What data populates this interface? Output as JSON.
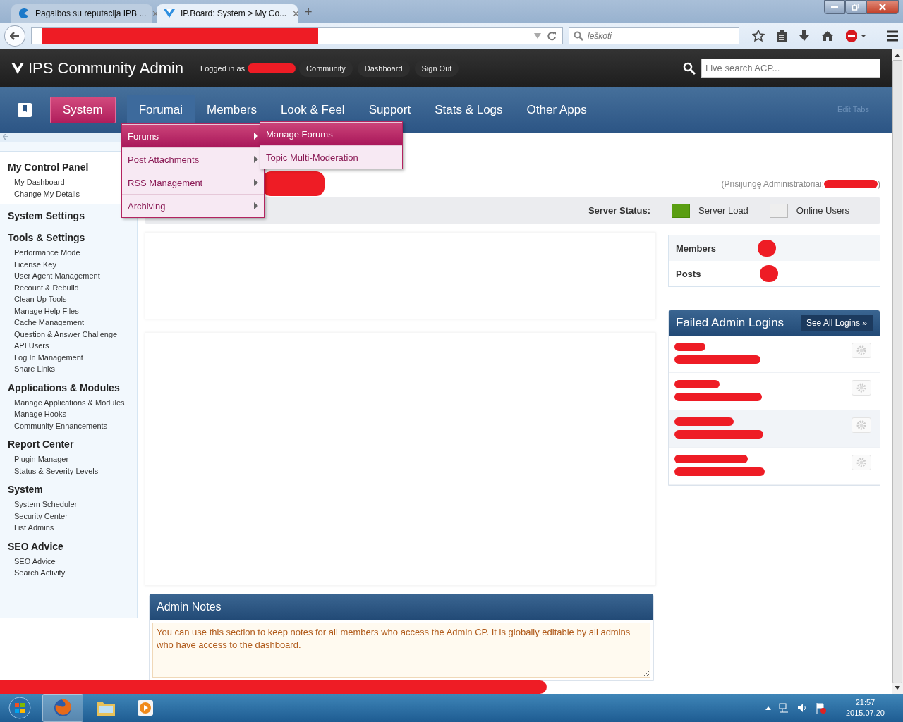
{
  "browser": {
    "tabs": [
      {
        "title": "Pagalbos su reputacija IPB ...",
        "selected": false
      },
      {
        "title": "IP.Board: System > My Co...",
        "selected": true
      }
    ],
    "close": "✕",
    "new_tab": "+",
    "search_placeholder": "leškoti"
  },
  "header": {
    "title": "IPS Community Admin",
    "logged_in": "Logged in as",
    "links": [
      "Community",
      "Dashboard",
      "Sign Out"
    ],
    "search_placeholder": "Live search ACP..."
  },
  "nav": {
    "tabs": [
      {
        "label": "System",
        "selected": true,
        "open": false
      },
      {
        "label": "Forumai",
        "selected": false,
        "open": true
      },
      {
        "label": "Members",
        "selected": false,
        "open": false
      },
      {
        "label": "Look & Feel",
        "selected": false,
        "open": false
      },
      {
        "label": "Support",
        "selected": false,
        "open": false
      },
      {
        "label": "Stats & Logs",
        "selected": false,
        "open": false
      },
      {
        "label": "Other Apps",
        "selected": false,
        "open": false
      }
    ],
    "edit": "Edit Tabs"
  },
  "menu": {
    "items": [
      {
        "label": "Forums",
        "selected": true
      },
      {
        "label": "Post Attachments",
        "selected": false
      },
      {
        "label": "RSS Management",
        "selected": false
      },
      {
        "label": "Archiving",
        "selected": false
      }
    ],
    "submenu": [
      {
        "label": "Manage Forums",
        "selected": true
      },
      {
        "label": "Topic Multi-Moderation",
        "selected": false
      }
    ]
  },
  "sidebar": {
    "sections": [
      {
        "title": "My Control Panel",
        "boxed": true,
        "items": [
          "My Dashboard",
          "Change My Details"
        ]
      },
      {
        "title": "System Settings",
        "boxed": false
      },
      {
        "title": "Tools & Settings",
        "boxed": false,
        "items": [
          "Performance Mode",
          "License Key",
          "User Agent Management",
          "Recount & Rebuild",
          "Clean Up Tools",
          "Manage Help Files",
          "Cache Management",
          "Question & Answer Challenge",
          "API Users",
          "Log In Management",
          "Share Links"
        ]
      },
      {
        "title": "Applications & Modules",
        "boxed": false,
        "items": [
          "Manage Applications & Modules",
          "Manage Hooks",
          "Community Enhancements"
        ]
      },
      {
        "title": "Report Center",
        "boxed": false,
        "items": [
          "Plugin Manager",
          "Status & Severity Levels"
        ]
      },
      {
        "title": "System",
        "boxed": false,
        "items": [
          "System Scheduler",
          "Security Center",
          "List Admins"
        ]
      },
      {
        "title": "SEO Advice",
        "boxed": false,
        "items": [
          "SEO Advice",
          "Search Activity"
        ]
      }
    ]
  },
  "admins_online": {
    "prefix": "(Prisijungę Administratoriai:",
    "suffix": ")"
  },
  "server_status": {
    "label": "Server Status:",
    "indicators": [
      {
        "label": "Server Load",
        "on": true
      },
      {
        "label": "Online Users",
        "on": false
      }
    ]
  },
  "stats": [
    "Members",
    "Posts"
  ],
  "failed_logins": {
    "title": "Failed Admin Logins",
    "button": "See All Logins »",
    "rows": [
      {
        "highlighted": false
      },
      {
        "highlighted": false
      },
      {
        "highlighted": true
      },
      {
        "highlighted": false
      }
    ]
  },
  "admin_notes": {
    "title": "Admin Notes",
    "text": "You can use this section to keep notes for all members who access the Admin CP. It is globally editable by all admins who have access to the dashboard."
  },
  "taskbar": {
    "time": "21:57",
    "date": "2015.07.20"
  }
}
